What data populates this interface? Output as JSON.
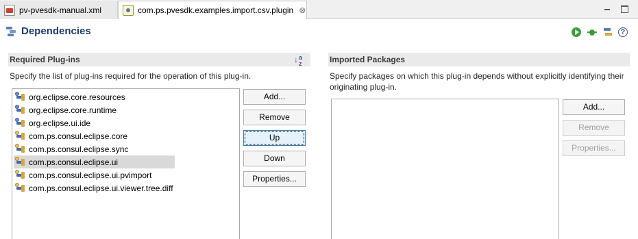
{
  "tabs": [
    {
      "label": "pv-pvesdk-manual.xml",
      "icon": "xml-file-icon"
    },
    {
      "label": "com.ps.pvesdk.examples.import.csv.plugin",
      "icon": "plugin-manifest-icon",
      "close": "⊗"
    }
  ],
  "header": {
    "title": "Dependencies",
    "help": "?"
  },
  "required": {
    "title": "Required Plug-ins",
    "description": "Specify the list of plug-ins required for the operation of this plug-in.",
    "sort_arrow": "↓",
    "sort_a": "a",
    "sort_z": "z",
    "items": [
      {
        "label": "org.eclipse.core.resources",
        "icon": "plugin-icon"
      },
      {
        "label": "org.eclipse.core.runtime",
        "icon": "plugin-icon"
      },
      {
        "label": "org.eclipse.ui.ide",
        "icon": "plugin-icon"
      },
      {
        "label": "com.ps.consul.eclipse.core",
        "icon": "plugin-icon"
      },
      {
        "label": "com.ps.consul.eclipse.sync",
        "icon": "plugin-icon"
      },
      {
        "label": "com.ps.consul.eclipse.ui",
        "icon": "plugin-icon",
        "selected": true
      },
      {
        "label": "com.ps.consul.eclipse.ui.pvimport",
        "icon": "plugin-icon"
      },
      {
        "label": "com.ps.consul.eclipse.ui.viewer.tree.diff",
        "icon": "plugin-icon"
      }
    ],
    "buttons": {
      "add": "Add...",
      "remove": "Remove",
      "up": "Up",
      "down": "Down",
      "properties": "Properties..."
    }
  },
  "imported": {
    "title": "Imported Packages",
    "description": "Specify packages on which this plug-in depends without explicitly identifying their originating plug-in.",
    "items": [],
    "buttons": {
      "add": "Add...",
      "remove": "Remove",
      "properties": "Properties..."
    }
  }
}
